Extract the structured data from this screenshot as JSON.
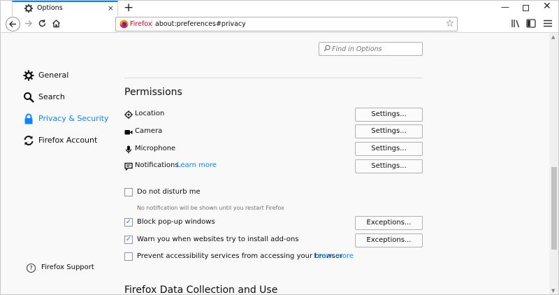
{
  "tab": {
    "title": "Options",
    "close": "×"
  },
  "toolbar": {
    "new_tab": "+",
    "window_min": "—",
    "window_close": "✕"
  },
  "urlbar": {
    "identity": "Firefox",
    "url": "about:preferences#privacy",
    "star": "☆"
  },
  "find": {
    "placeholder": "Find in Options"
  },
  "sidebar": {
    "items": [
      {
        "label": "General",
        "icon": "gear-icon"
      },
      {
        "label": "Search",
        "icon": "search-icon"
      },
      {
        "label": "Privacy & Security",
        "icon": "lock-icon",
        "selected": true
      },
      {
        "label": "Firefox Account",
        "icon": "sync-icon"
      }
    ],
    "support": "Firefox Support"
  },
  "permissions": {
    "title": "Permissions",
    "rows": [
      {
        "label": "Location",
        "button": "Settings..."
      },
      {
        "label": "Camera",
        "button": "Settings..."
      },
      {
        "label": "Microphone",
        "button": "Settings..."
      },
      {
        "label": "Notifications",
        "learn_more": "Learn more",
        "button": "Settings..."
      }
    ],
    "do_not_disturb": {
      "label": "Do not disturb me",
      "checked": false,
      "note": "No notification will be shown until you restart Firefox"
    },
    "block_popups": {
      "label": "Block pop-up windows",
      "checked": true,
      "button": "Exceptions..."
    },
    "warn_addons": {
      "label": "Warn you when websites try to install add-ons",
      "checked": true,
      "button": "Exceptions..."
    },
    "accessibility": {
      "label": "Prevent accessibility services from accessing your browser",
      "checked": false,
      "learn_more": "Learn more"
    }
  },
  "next_section": {
    "title": "Firefox Data Collection and Use"
  },
  "colors": {
    "accent": "#0a84ff",
    "brand": "#d70022"
  }
}
